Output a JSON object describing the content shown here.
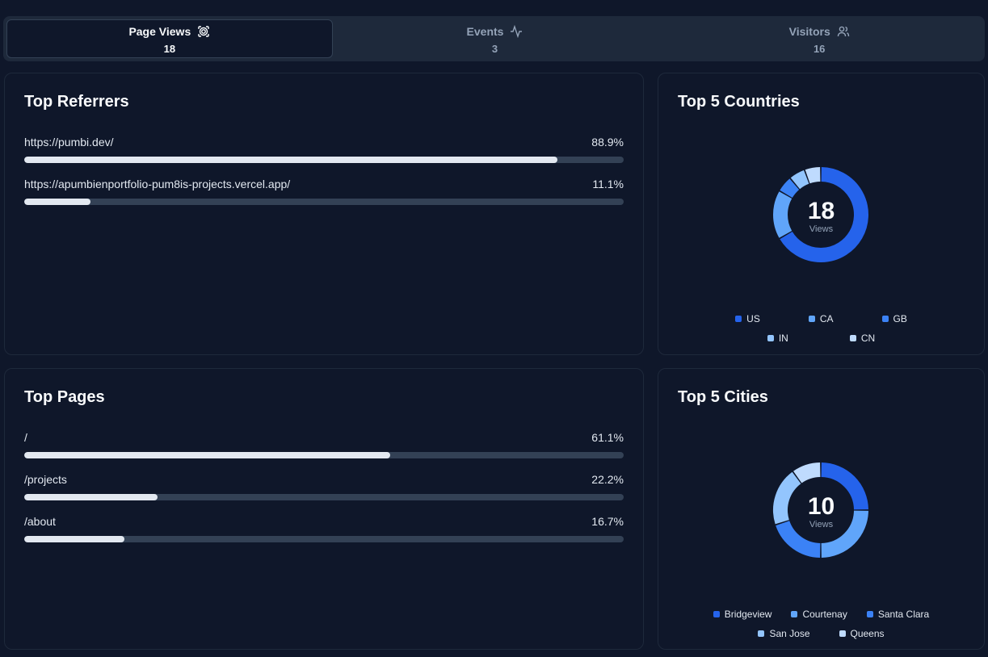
{
  "tabs": [
    {
      "label": "Page Views",
      "count": "18",
      "icon": "eye-icon"
    },
    {
      "label": "Events",
      "count": "3",
      "icon": "activity-icon"
    },
    {
      "label": "Visitors",
      "count": "16",
      "icon": "users-icon"
    }
  ],
  "referrers": {
    "title": "Top Referrers",
    "items": [
      {
        "label": "https://pumbi.dev/",
        "pct": "88.9%",
        "value": 88.9
      },
      {
        "label": "https://apumbienportfolio-pum8is-projects.vercel.app/",
        "pct": "11.1%",
        "value": 11.1
      }
    ]
  },
  "pages": {
    "title": "Top Pages",
    "items": [
      {
        "label": "/",
        "pct": "61.1%",
        "value": 61.1
      },
      {
        "label": "/projects",
        "pct": "22.2%",
        "value": 22.2
      },
      {
        "label": "/about",
        "pct": "16.7%",
        "value": 16.7
      }
    ]
  },
  "countries": {
    "title": "Top 5 Countries",
    "total": "18",
    "sub": "Views",
    "legend": [
      "US",
      "CA",
      "GB",
      "IN",
      "CN"
    ],
    "colors": [
      "#2563eb",
      "#60a5fa",
      "#3b82f6",
      "#93c5fd",
      "#bfdbfe"
    ],
    "values": [
      12,
      3,
      1,
      1,
      1
    ]
  },
  "cities": {
    "title": "Top 5 Cities",
    "total": "10",
    "sub": "Views",
    "legend": [
      "Bridgeview",
      "Courtenay",
      "Santa Clara",
      "San Jose",
      "Queens"
    ],
    "colors": [
      "#2563eb",
      "#60a5fa",
      "#3b82f6",
      "#93c5fd",
      "#bfdbfe"
    ],
    "values": [
      2.5,
      2.5,
      2,
      2,
      1
    ]
  }
}
